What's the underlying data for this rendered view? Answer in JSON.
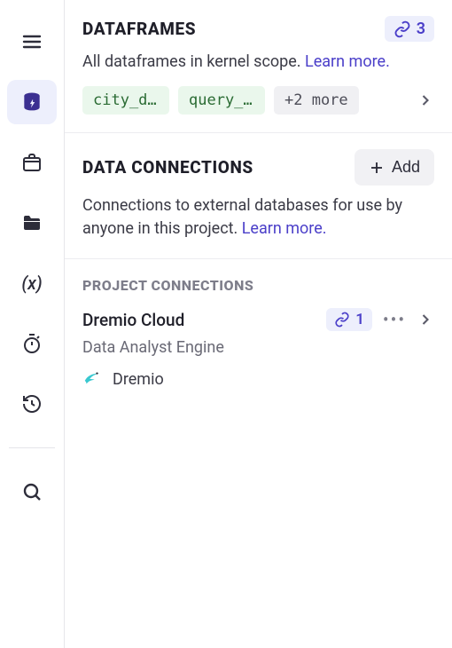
{
  "dataframes": {
    "title": "DATAFRAMES",
    "count": "3",
    "description": "All dataframes in kernel scope. ",
    "learn_more": "Learn more.",
    "chips": [
      "city_dri…",
      "query_r…"
    ],
    "more_chip": "+2 more"
  },
  "connections": {
    "title": "DATA CONNECTIONS",
    "add_label": "Add",
    "description": "Connections to external databases for use by anyone in this project. ",
    "learn_more": "Learn more."
  },
  "project_connections": {
    "subhead": "PROJECT CONNECTIONS",
    "items": [
      {
        "name": "Dremio Cloud",
        "link_count": "1",
        "subtitle": "Data Analyst Engine",
        "vendor": "Dremio"
      }
    ]
  }
}
